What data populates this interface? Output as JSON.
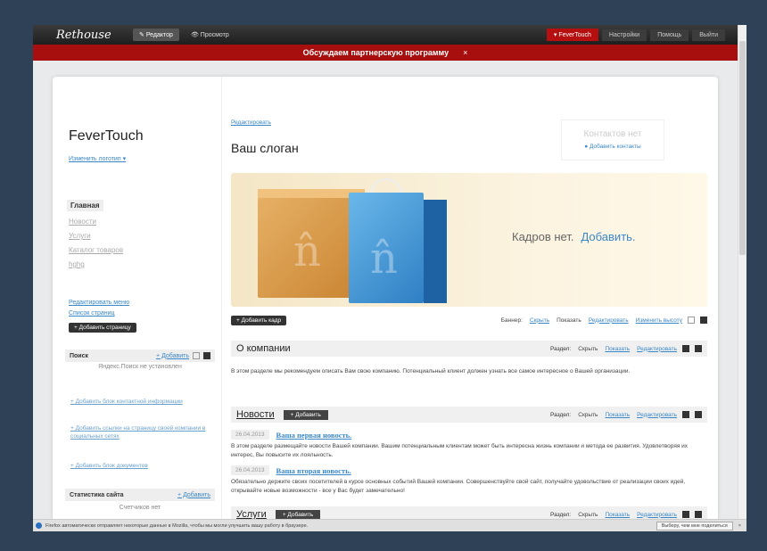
{
  "topbar": {
    "logo": "Rethouse",
    "editor": "Редактор",
    "preview": "Просмотр",
    "user": "FeverTouch",
    "settings": "Настройки",
    "help": "Помощь",
    "logout": "Выйти"
  },
  "promo": {
    "text": "Обсуждаем партнерскую программу",
    "close": "×"
  },
  "sidebar": {
    "site_name": "FeverTouch",
    "change_logo": "Изменить логотип",
    "menu": [
      "Главная",
      "Новости",
      "Услуги",
      "Каталог товаров",
      "hghg"
    ],
    "edit_menu": "Редактировать меню",
    "page_list": "Список страниц",
    "add_page": "+ Добавить страницу",
    "search_widget": {
      "title": "Поиск",
      "add": "+ Добавить",
      "note": "Яндекс.Поиск не установлен"
    },
    "add_contacts_block": "+ Добавить блок контактной информации",
    "add_social_links": "+ Добавить ссылки на страницу своей компании в социальных сетях",
    "add_docs_block": "+ Добавить блок документов",
    "stats_widget": {
      "title": "Статистика сайта",
      "add": "+ Добавить",
      "note": "Счетчиков нет"
    }
  },
  "main": {
    "edit": "Редактировать",
    "slogan": "Ваш слоган",
    "contacts": {
      "title": "Контактов нет",
      "add": "● Добавить контакты"
    },
    "banner": {
      "no_frames": "Кадров нет.",
      "add": "Добавить."
    },
    "banner_tools": {
      "add_frame": "+ Добавить кадр",
      "label": "Баннер:",
      "hide": "Скрыть",
      "show": "Показать",
      "edit": "Редактировать",
      "change_height": "Изменить высоту"
    },
    "about": {
      "title": "О компании",
      "section_label": "Раздел:",
      "hide": "Скрыть",
      "show": "Показать",
      "edit": "Редактировать",
      "text": "В этом разделе мы рекомендуем описать Вам свою компанию. Потенциальный клиент должен узнать все самое интересное о Вашей организации."
    },
    "news": {
      "title": "Новости",
      "add": "+ Добавить",
      "section_label": "Раздел:",
      "hide": "Скрыть",
      "show": "Показать",
      "edit": "Редактировать",
      "items": [
        {
          "date": "26.04.2013",
          "title": "Ваша первая новость.",
          "text": "В этом разделе размещайте новости Вашей компании. Вашим потенциальным клиентам может быть интересна жизнь компании и метода ее развития. Удовлетворяя их интерес, Вы повысите их лояльность."
        },
        {
          "date": "26.04.2013",
          "title": "Ваша вторая новость.",
          "text": "Обязательно держите своих посетителей в курсе основных событий Вашей компании. Совершенствуйте свой сайт, получайте удовольствие от реализации своих идей, открывайте новые возможности - все у Вас будет замечательно!"
        }
      ]
    },
    "services": {
      "title": "Услуги",
      "add": "+ Добавить",
      "section_label": "Раздел:",
      "hide": "Скрыть",
      "show": "Показать",
      "edit": "Редактировать"
    }
  },
  "statusbar": {
    "text": "Firefox автоматически отправляет некоторые данные в Mozilla, чтобы мы могли улучшить вашу работу в браузере.",
    "action": "Выберу, чем мне поделиться",
    "close": "×"
  }
}
